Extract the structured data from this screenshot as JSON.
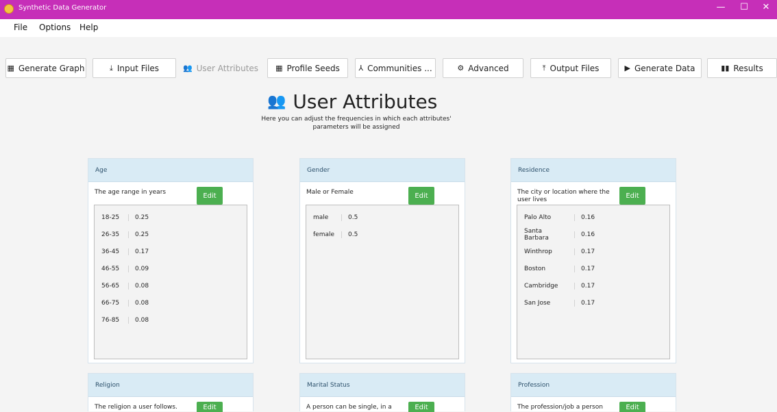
{
  "window": {
    "title": "Synthetic Data Generator",
    "min": "—",
    "max": "☐",
    "close": "✕"
  },
  "menu": {
    "file": "File",
    "options": "Options",
    "help": "Help"
  },
  "toolbar": {
    "generate_graph": "Generate Graph",
    "input_files": "Input Files",
    "user_attributes": "User Attributes",
    "profile_seeds": "Profile Seeds",
    "communities": "Communities ...",
    "advanced": "Advanced",
    "output_files": "Output Files",
    "generate_data": "Generate Data",
    "results": "Results"
  },
  "page": {
    "title": "User Attributes",
    "subtitle": "Here you can adjust the frequencies in which each attributes' parameters will be assigned"
  },
  "edit_label": "Edit",
  "cards": {
    "age": {
      "title": "Age",
      "description": "The age range in years",
      "rows": [
        {
          "k": "18-25",
          "v": "0.25"
        },
        {
          "k": "26-35",
          "v": "0.25"
        },
        {
          "k": "36-45",
          "v": "0.17"
        },
        {
          "k": "46-55",
          "v": "0.09"
        },
        {
          "k": "56-65",
          "v": "0.08"
        },
        {
          "k": "66-75",
          "v": "0.08"
        },
        {
          "k": "76-85",
          "v": "0.08"
        }
      ]
    },
    "gender": {
      "title": "Gender",
      "description": "Male or Female",
      "rows": [
        {
          "k": "male",
          "v": "0.5"
        },
        {
          "k": "female",
          "v": "0.5"
        }
      ]
    },
    "residence": {
      "title": "Residence",
      "description": "The city or location where the user lives",
      "rows": [
        {
          "k": "Palo Alto",
          "v": "0.16"
        },
        {
          "k": "Santa Barbara",
          "v": "0.16"
        },
        {
          "k": "Winthrop",
          "v": "0.17"
        },
        {
          "k": "Boston",
          "v": "0.17"
        },
        {
          "k": "Cambridge",
          "v": "0.17"
        },
        {
          "k": "San Jose",
          "v": "0.17"
        }
      ]
    },
    "religion": {
      "title": "Religion",
      "description": "The religion a user follows."
    },
    "marital": {
      "title": "Marital Status",
      "description": "A person can be single, in a"
    },
    "profession": {
      "title": "Profession",
      "description": "The profession/job a person"
    }
  },
  "icons": {
    "app": "app-icon",
    "graph": "grid-icon",
    "input": "download-icon",
    "users": "users-icon",
    "seeds": "grid-icon",
    "communities": "network-icon",
    "advanced": "gear-icon",
    "output": "upload-icon",
    "play": "play-icon",
    "results": "bar-chart-icon"
  }
}
